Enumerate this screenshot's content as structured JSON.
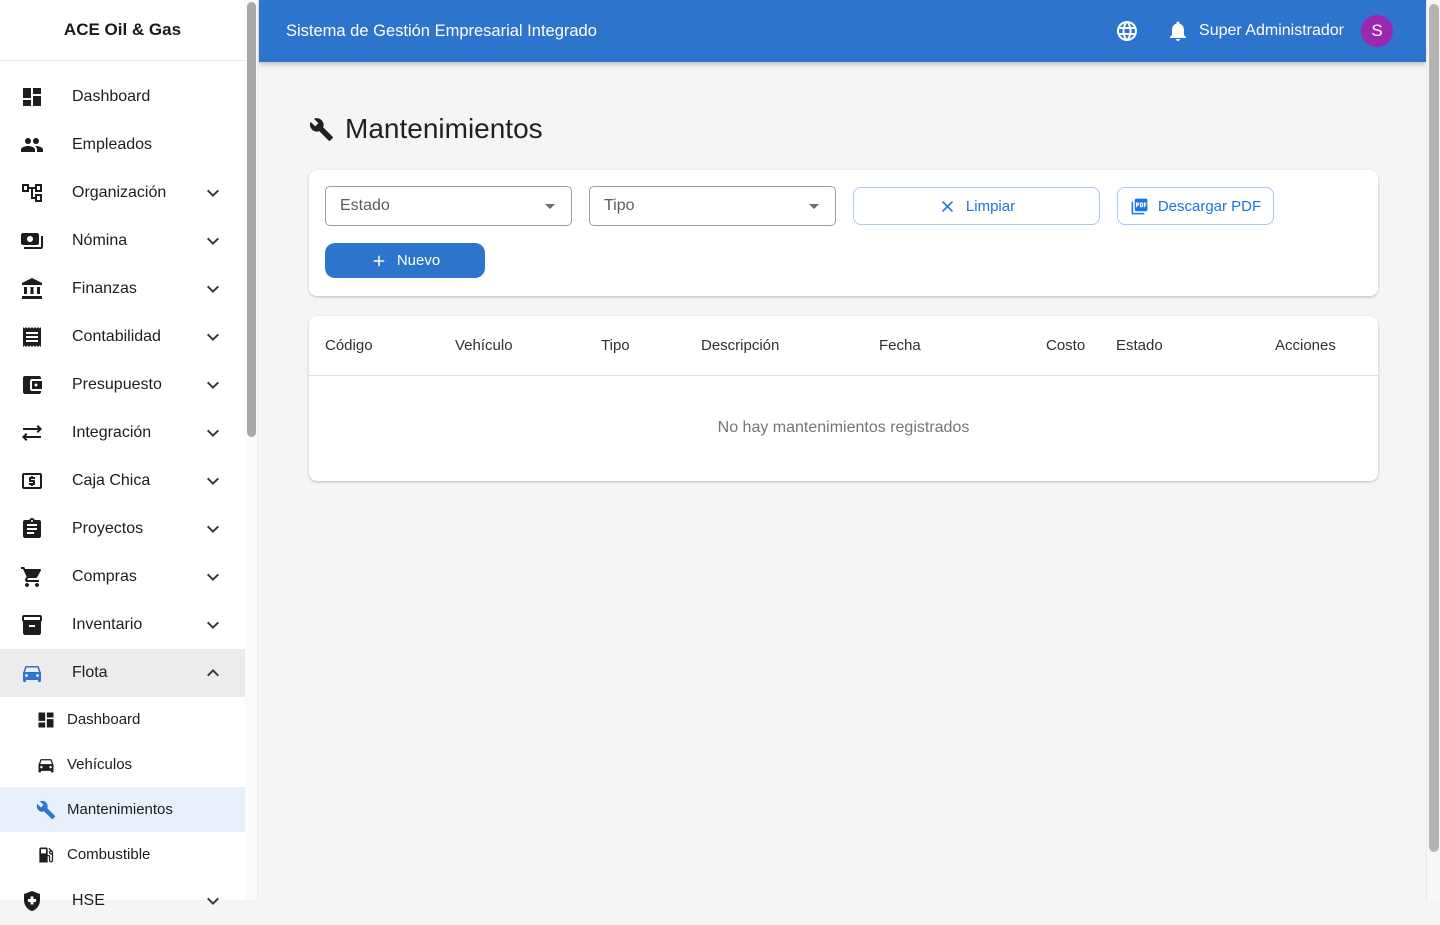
{
  "app": {
    "brand": "ACE Oil & Gas",
    "topbar": {
      "title": "Sistema de Gestión Empresarial Integrado",
      "user": "Super Administrador",
      "avatar_initial": "S"
    },
    "colors": {
      "primary": "#2d74cc",
      "link_blue": "#1a73e8",
      "avatar_purple": "#9c27b0",
      "selected_bg": "#e8f1fb",
      "expanded_bg": "#ececec"
    }
  },
  "sidebar": {
    "items": [
      {
        "label": "Dashboard",
        "icon": "dashboard-icon",
        "chevron": "none"
      },
      {
        "label": "Empleados",
        "icon": "people-icon",
        "chevron": "none"
      },
      {
        "label": "Organización",
        "icon": "org-tree-icon",
        "chevron": "down"
      },
      {
        "label": "Nómina",
        "icon": "payments-icon",
        "chevron": "down"
      },
      {
        "label": "Finanzas",
        "icon": "bank-icon",
        "chevron": "down"
      },
      {
        "label": "Contabilidad",
        "icon": "receipt-icon",
        "chevron": "down"
      },
      {
        "label": "Presupuesto",
        "icon": "wallet-icon",
        "chevron": "down"
      },
      {
        "label": "Integración",
        "icon": "sync-icon",
        "chevron": "down"
      },
      {
        "label": "Caja Chica",
        "icon": "cash-icon",
        "chevron": "down"
      },
      {
        "label": "Proyectos",
        "icon": "clipboard-icon",
        "chevron": "down"
      },
      {
        "label": "Compras",
        "icon": "cart-icon",
        "chevron": "down"
      },
      {
        "label": "Inventario",
        "icon": "inventory-icon",
        "chevron": "down"
      },
      {
        "label": "Flota",
        "icon": "car-icon",
        "chevron": "up"
      }
    ],
    "flota_subitems": [
      {
        "label": "Dashboard",
        "icon": "dashboard-icon"
      },
      {
        "label": "Vehículos",
        "icon": "car-icon"
      },
      {
        "label": "Mantenimientos",
        "icon": "wrench-icon",
        "selected": true
      },
      {
        "label": "Combustible",
        "icon": "fuel-icon"
      }
    ],
    "partial_item": {
      "label": "HSE",
      "icon": "shield-icon",
      "chevron": "down"
    }
  },
  "page": {
    "title": "Mantenimientos",
    "filters": {
      "estado_label": "Estado",
      "tipo_label": "Tipo",
      "limpiar_label": "Limpiar",
      "descargar_label": "Descargar PDF",
      "nuevo_label": "Nuevo"
    },
    "table": {
      "columns": [
        "Código",
        "Vehículo",
        "Tipo",
        "Descripción",
        "Fecha",
        "Costo",
        "Estado",
        "Acciones"
      ],
      "empty_message": "No hay mantenimientos registrados"
    }
  }
}
